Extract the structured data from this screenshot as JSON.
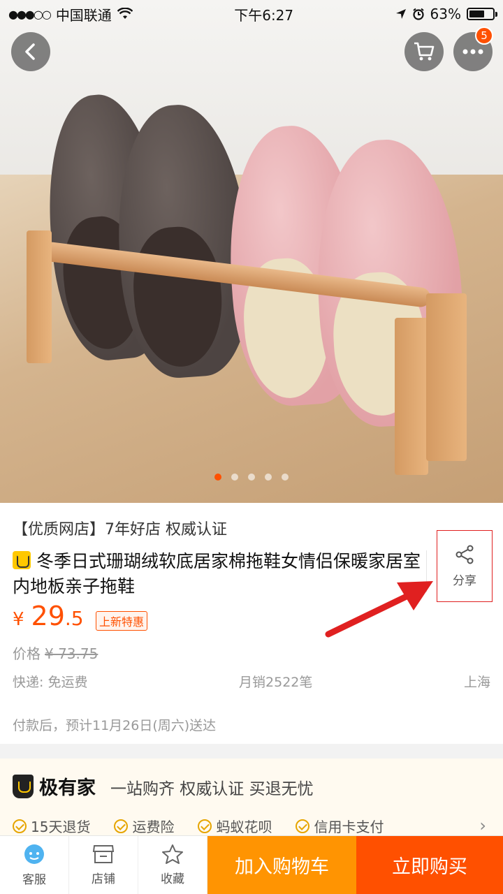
{
  "status_bar": {
    "carrier": "中国联通",
    "time": "下午6:27",
    "battery_percent": "63%"
  },
  "hero": {
    "cart_badge_count": "5",
    "carousel_total": 5,
    "carousel_active": 1
  },
  "product": {
    "shop_tag": "【优质网店】7年好店 权威认证",
    "title": "冬季日式珊瑚绒软底居家棉拖鞋女情侣保暖家居室内地板亲子拖鞋",
    "share_label": "分享",
    "price_currency": "¥",
    "price_int": "29",
    "price_dec": ".5",
    "price_tag": "上新特惠",
    "orig_label": "价格",
    "orig_price": "¥ 73.75",
    "shipping": "快递: 免运费",
    "monthly_sales": "月销2522笔",
    "location": "上海",
    "delivery": "付款后，预计11月26日(周六)送达"
  },
  "promo": {
    "brand": "极有家",
    "slogan": "一站购齐 权威认证 买退无忧",
    "items": [
      {
        "label": "15天退货"
      },
      {
        "label": "运费险"
      },
      {
        "label": "蚂蚁花呗"
      },
      {
        "label": "信用卡支付"
      }
    ]
  },
  "bottom_bar": {
    "service_label": "客服",
    "store_label": "店铺",
    "favorite_label": "收藏",
    "add_to_cart_label": "加入购物车",
    "buy_now_label": "立即购买"
  },
  "colors": {
    "accent": "#ff5000",
    "cart_button": "#ff9402",
    "annotation_red": "#e02020"
  }
}
